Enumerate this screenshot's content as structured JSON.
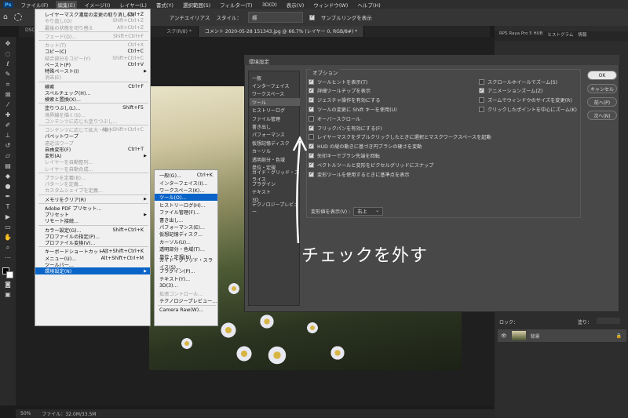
{
  "menubar": {
    "items": [
      "ファイル(F)",
      "編集(E)",
      "イメージ(I)",
      "レイヤー(L)",
      "書式(Y)",
      "選択範囲(S)",
      "フィルター(T)",
      "3D(D)",
      "表示(V)",
      "ウィンドウ(W)",
      "ヘルプ(H)"
    ]
  },
  "optbar": {
    "antialias": "アンチエイリアス",
    "style_label": "スタイル：",
    "style_value": "標",
    "sample_label": "サンプルリングを表示"
  },
  "tabs": [
    "DSC_90",
    "スク(R/8) *",
    "コメント 2020-05-28 151343.jpg @ 66.7% (レイヤー 0, RGB/8#) *"
  ],
  "edit_menu": [
    {
      "label": "レイヤーマスク濃度の変更の取り消し(O)",
      "shortcut": "Ctrl+Z",
      "disabled": false
    },
    {
      "label": "やり直し(O)",
      "shortcut": "Shift+Ctrl+Z",
      "disabled": true
    },
    {
      "label": "最後の状態を切り替え",
      "shortcut": "Alt+Ctrl+Z",
      "disabled": true
    },
    {
      "sep": true
    },
    {
      "label": "フェード(D)...",
      "shortcut": "Shift+Ctrl+F",
      "disabled": true
    },
    {
      "sep": true
    },
    {
      "label": "カット(T)",
      "shortcut": "Ctrl+X",
      "disabled": true
    },
    {
      "label": "コピー(C)",
      "shortcut": "Ctrl+C",
      "disabled": false
    },
    {
      "label": "結合部分をコピー(Y)",
      "shortcut": "Shift+Ctrl+C",
      "disabled": true
    },
    {
      "label": "ペースト(P)",
      "shortcut": "Ctrl+V",
      "disabled": false
    },
    {
      "label": "特殊ペースト(I)",
      "shortcut": "",
      "disabled": false,
      "submenu": true
    },
    {
      "label": "消去(E)",
      "shortcut": "",
      "disabled": true
    },
    {
      "sep": true
    },
    {
      "label": "検索",
      "shortcut": "Ctrl+F",
      "disabled": false
    },
    {
      "label": "スペルチェック(H)...",
      "shortcut": "",
      "disabled": false
    },
    {
      "label": "検索と置換(X)...",
      "shortcut": "",
      "disabled": false
    },
    {
      "sep": true
    },
    {
      "label": "塗りつぶし(L)...",
      "shortcut": "Shift+F5",
      "disabled": false
    },
    {
      "label": "境界線を描く(S)...",
      "shortcut": "",
      "disabled": true
    },
    {
      "label": "コンテンツに応じた塗りつぶし...",
      "shortcut": "",
      "disabled": true
    },
    {
      "sep": true
    },
    {
      "label": "コンテンツに応じて拡大・縮小",
      "shortcut": "Alt+Shift+Ctrl+C",
      "disabled": true
    },
    {
      "label": "パペットワープ",
      "shortcut": "",
      "disabled": false
    },
    {
      "label": "遠近法ワープ",
      "shortcut": "",
      "disabled": true
    },
    {
      "label": "自由変形(F)",
      "shortcut": "Ctrl+T",
      "disabled": false
    },
    {
      "label": "変形(A)",
      "shortcut": "",
      "disabled": false,
      "submenu": true
    },
    {
      "label": "レイヤーを自動整列...",
      "shortcut": "",
      "disabled": true
    },
    {
      "label": "レイヤーを自動合成...",
      "shortcut": "",
      "disabled": true
    },
    {
      "sep": true
    },
    {
      "label": "ブラシを定義(B)...",
      "shortcut": "",
      "disabled": true
    },
    {
      "label": "パターンを定義...",
      "shortcut": "",
      "disabled": true
    },
    {
      "label": "カスタムシェイプを定義...",
      "shortcut": "",
      "disabled": true
    },
    {
      "sep": true
    },
    {
      "label": "メモリをクリア(R)",
      "shortcut": "",
      "disabled": false,
      "submenu": true
    },
    {
      "sep": true
    },
    {
      "label": "Adobe PDF プリセット...",
      "shortcut": "",
      "disabled": false
    },
    {
      "label": "プリセット",
      "shortcut": "",
      "disabled": false,
      "submenu": true
    },
    {
      "label": "リモート接続...",
      "shortcut": "",
      "disabled": false
    },
    {
      "sep": true
    },
    {
      "label": "カラー設定(G)...",
      "shortcut": "Shift+Ctrl+K",
      "disabled": false
    },
    {
      "label": "プロファイルの指定(P)...",
      "shortcut": "",
      "disabled": false
    },
    {
      "label": "プロファイル変換(V)...",
      "shortcut": "",
      "disabled": false
    },
    {
      "sep": true
    },
    {
      "label": "キーボードショートカット...",
      "shortcut": "Alt+Shift+Ctrl+K",
      "disabled": false
    },
    {
      "label": "メニュー(U)...",
      "shortcut": "Alt+Shift+Ctrl+M",
      "disabled": false
    },
    {
      "label": "ツールバー...",
      "shortcut": "",
      "disabled": false
    },
    {
      "label": "環境設定(N)",
      "shortcut": "",
      "disabled": false,
      "submenu": true,
      "selected": true
    }
  ],
  "submenu": [
    {
      "label": "一般(G)...",
      "shortcut": "Ctrl+K"
    },
    {
      "label": "インターフェイス(I)..."
    },
    {
      "label": "ワークスペース(K)..."
    },
    {
      "label": "ツール(O)...",
      "selected": true
    },
    {
      "label": "ヒストリーログ(H)..."
    },
    {
      "label": "ファイル管理(F)..."
    },
    {
      "label": "書き出し..."
    },
    {
      "label": "パフォーマンス(E)..."
    },
    {
      "label": "仮想記憶ディスク..."
    },
    {
      "label": "カーソル(U)..."
    },
    {
      "label": "透明部分・色域(T)..."
    },
    {
      "label": "単位・定規(N)..."
    },
    {
      "label": "ガイド・グリッド・スライス(S)..."
    },
    {
      "label": "プラグイン(P)..."
    },
    {
      "label": "テキスト(Y)..."
    },
    {
      "label": "3D(3)..."
    },
    {
      "label": "拡張コントロール...",
      "disabled": true
    },
    {
      "label": "テクノロジープレビュー..."
    },
    {
      "sep": true
    },
    {
      "label": "Camera Raw(W)..."
    }
  ],
  "prefs": {
    "title": "環境設定",
    "categories": [
      "一般",
      "インターフェイス",
      "ワークスペース",
      "ツール",
      "ヒストリーログ",
      "ファイル管理",
      "書き出し",
      "パフォーマンス",
      "仮想記憶ディスク",
      "カーソル",
      "透明部分・色域",
      "単位・定規",
      "ガイド・グリッド・スライス",
      "プラグイン",
      "テキスト",
      "3D",
      "テクノロジープレビュー"
    ],
    "selected_index": 3,
    "options_legend": "オプション",
    "options_left": [
      {
        "label": "ツールヒントを表示(T)",
        "checked": true
      },
      {
        "label": "詳細ツールチップを表示",
        "checked": true
      },
      {
        "label": "ジェスチャ操作を有効にする",
        "checked": true
      },
      {
        "label": "ツールの変更に Shift キーを使用(U)",
        "checked": true
      },
      {
        "label": "オーバースクロール",
        "checked": false
      },
      {
        "label": "フリックパンを有効にする(F)",
        "checked": true
      },
      {
        "label": "レイヤーマスクをダブルクリックしたときに選択とマスクワークスペースを起動",
        "checked": false
      },
      {
        "label": "HUD の縦の動きに基づき円ブラシの硬さを変動",
        "checked": true
      },
      {
        "label": "矢印キーでブラシ先端を回転",
        "checked": true
      },
      {
        "label": "ベクトルツールと変形をピクセルグリッドにスナップ",
        "checked": true
      },
      {
        "label": "変形ツールを使用するときに基準点を表示",
        "checked": true
      }
    ],
    "options_right": [
      {
        "label": "スクロールホイールでズーム(S)",
        "checked": false
      },
      {
        "label": "アニメーションズーム(Z)",
        "checked": true
      },
      {
        "label": "ズームでウィンドウのサイズを変更(R)",
        "checked": false
      },
      {
        "label": "クリックしたポイントを中心にズーム(K)",
        "checked": false
      }
    ],
    "transform_label": "変形値を表示(V) :",
    "transform_value": "右上",
    "buttons": [
      "OK",
      "キャンセル",
      "前へ(P)",
      "次へ(N)"
    ]
  },
  "right_panel": {
    "tabs": [
      "RPS Raya Pro 5 HUB",
      "ヒストグラム",
      "情報"
    ],
    "lock_label": "ロック：",
    "opacity_label": "塗り：",
    "layer_name": "背景"
  },
  "status": {
    "zoom": "50%",
    "file": "ファイル：32.0M/33.5M"
  },
  "annotation": "チェックを外す"
}
